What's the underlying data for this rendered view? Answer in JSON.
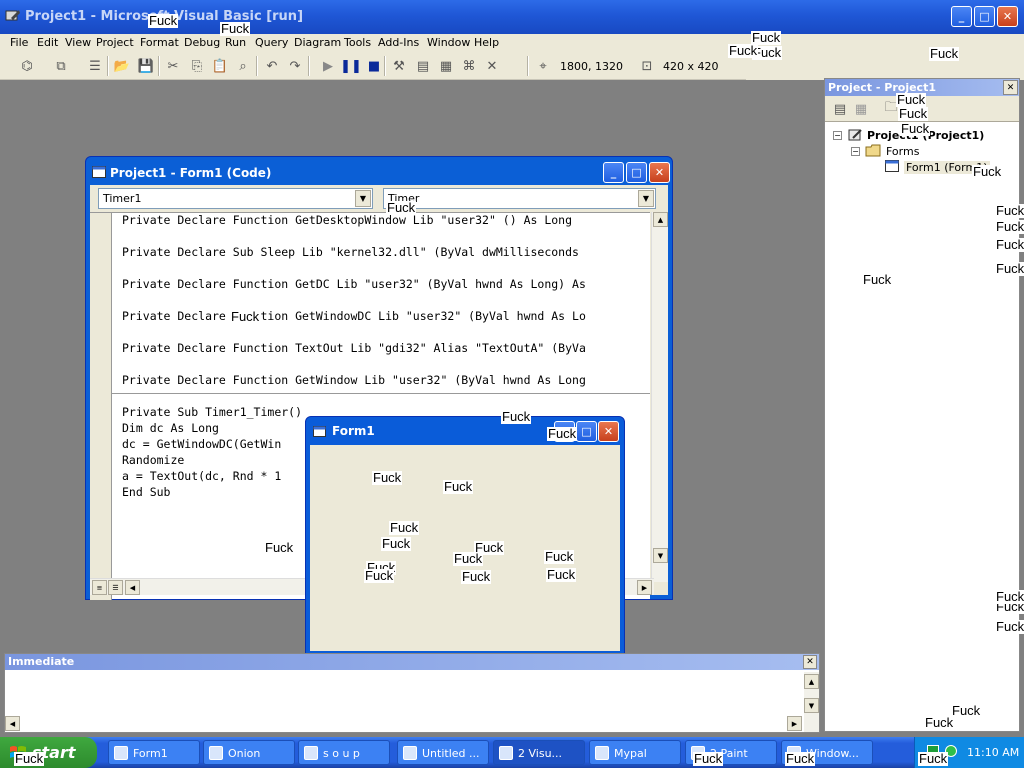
{
  "window": {
    "title": "Project1 - Microsoft Visual Basic [run]"
  },
  "menu": [
    "File",
    "Edit",
    "View",
    "Project",
    "Format",
    "Debug",
    "Run",
    "Query",
    "Diagram",
    "Tools",
    "Add-Ins",
    "Window",
    "Help"
  ],
  "toolbar": {
    "position": "1800, 1320",
    "size": "420 x 420"
  },
  "code_window": {
    "title": "Project1 - Form1 (Code)",
    "object_combo": "Timer1",
    "procedure_combo": "Timer",
    "declarations": [
      "Private Declare Function GetDesktopWindow Lib \"user32\" () As Long",
      "Private Declare Sub Sleep Lib \"kernel32.dll\" (ByVal dwMilliseconds",
      "Private Declare Function GetDC Lib \"user32\" (ByVal hwnd As Long) As",
      "Private Declare Function GetWindowDC Lib \"user32\" (ByVal hwnd As Lo",
      "Private Declare Function TextOut Lib \"gdi32\" Alias \"TextOutA\" (ByVa",
      "Private Declare Function GetWindow Lib \"user32\" (ByVal hwnd As Long"
    ],
    "sub_lines": [
      "Private Sub Timer1_Timer()",
      "Dim dc As Long",
      "dc = GetWindowDC(GetWin",
      "Randomize",
      "a = TextOut(dc, Rnd * 1",
      "End Sub"
    ]
  },
  "form1": {
    "title": "Form1"
  },
  "project_explorer": {
    "title": "Project - Project1",
    "root": "Project1 (Project1)",
    "folder": "Forms",
    "form": "Form1 (Form1)"
  },
  "immediate": {
    "title": "Immediate"
  },
  "taskbar": {
    "start": "start",
    "tasks": [
      "Form1",
      "Onion",
      "s o u p",
      "Untitled ...",
      "2 Visu...",
      "Mypal",
      "2 Paint",
      "Window..."
    ],
    "clock": "11:10 AM"
  },
  "scribble_text": "Fuck",
  "scribble_count": 40
}
